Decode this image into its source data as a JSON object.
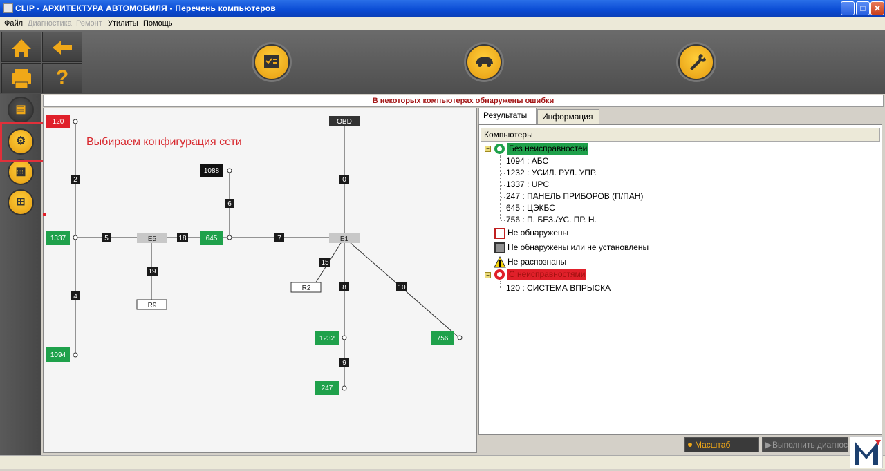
{
  "window": {
    "title": "CLIP - АРХИТЕКТУРА АВТОМОБИЛЯ - Перечень компьютеров"
  },
  "menu": {
    "file": "Файл",
    "diag": "Диагностика",
    "repair": "Ремонт",
    "utils": "Утилиты",
    "help": "Помощь"
  },
  "notice": "В некоторых компьютерах обнаружены ошибки",
  "annotation": "Выбираем конфигурация сети",
  "nodes": {
    "n120": "120",
    "n1337": "1337",
    "n1094": "1094",
    "n645": "645",
    "n1088": "1088",
    "nE5": "E5",
    "nR9": "R9",
    "nOBD": "OBD",
    "nE1": "E1",
    "nR2": "R2",
    "n1232": "1232",
    "n247": "247",
    "n756": "756"
  },
  "edges": {
    "e2": "2",
    "e4": "4",
    "e5": "5",
    "e18": "18",
    "e6": "6",
    "e7": "7",
    "e19": "19",
    "e0": "0",
    "e15": "15",
    "e8": "8",
    "e10": "10",
    "e9": "9"
  },
  "tabs": {
    "results": "Результаты",
    "info": "Информация"
  },
  "tree": {
    "header": "Компьютеры",
    "ok": "Без неисправностей",
    "ok_items": [
      "1094 : АБС",
      "1232 : УСИЛ. РУЛ. УПР.",
      "1337 : UPC",
      "247 : ПАНЕЛЬ ПРИБОРОВ (П/ПАН)",
      "645 : ЦЭКБС",
      "756 : П. БЕЗ./УС. ПР. Н."
    ],
    "not_found": "Не обнаружены",
    "not_found_or_installed": "Не обнаружены или не установлены",
    "unrecognized": "Не распознаны",
    "faulty": "С неисправностями",
    "faulty_items": [
      "120 : СИСТЕМА ВПРЫСКА"
    ]
  },
  "buttons": {
    "scale": "Масштаб",
    "run_diag": "Выполнить диагностику"
  },
  "colors": {
    "ecu_ok": "#1fa14b",
    "ecu_fault": "#e0202a",
    "accent": "#f0a818"
  }
}
